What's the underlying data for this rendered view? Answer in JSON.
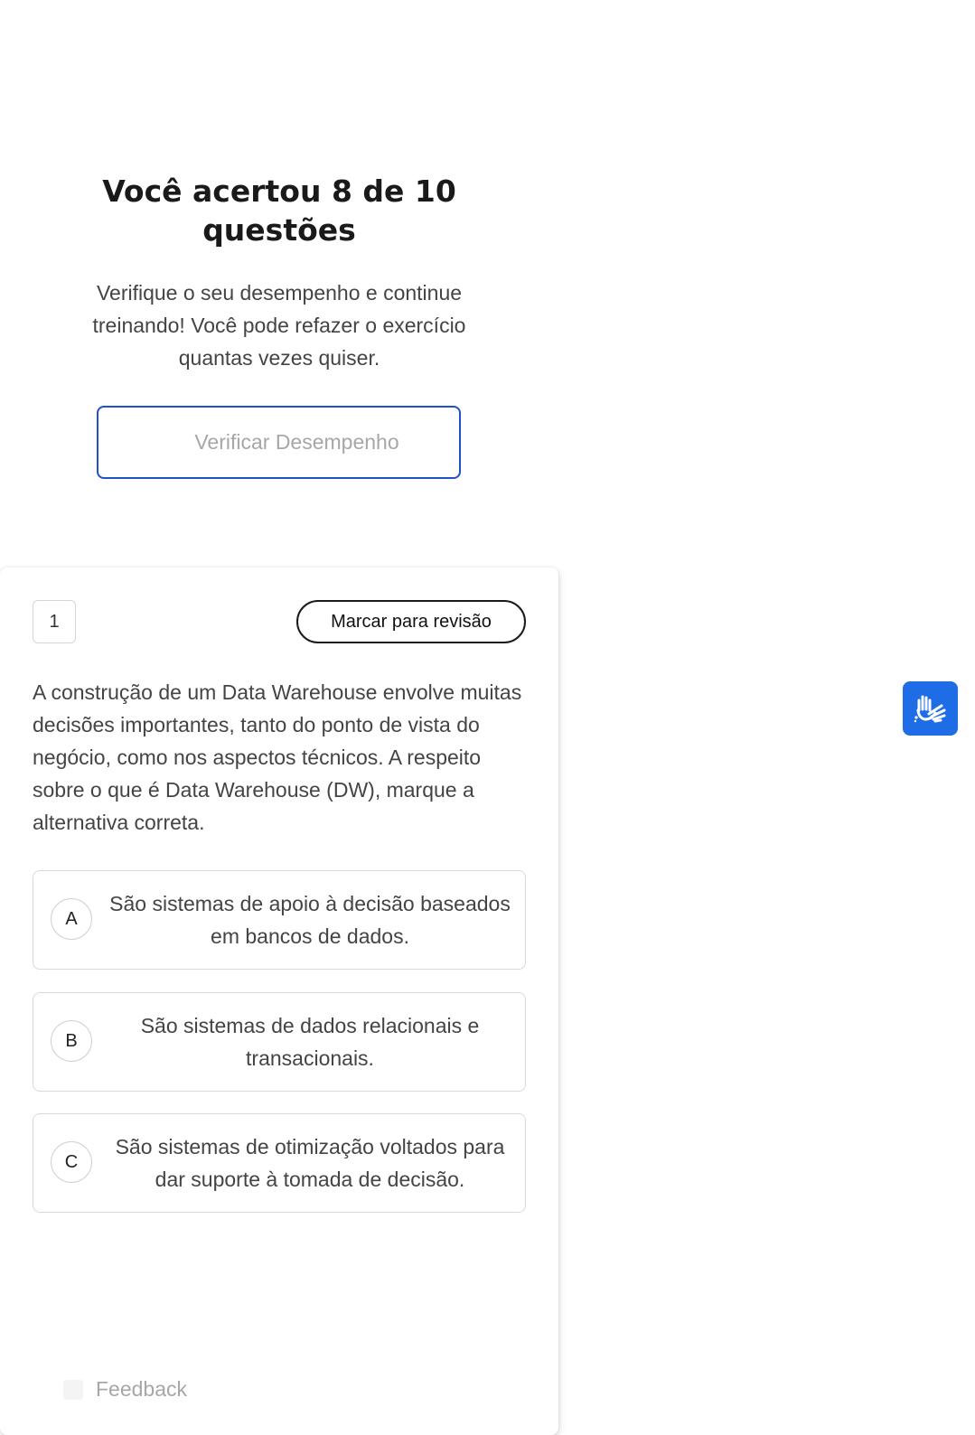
{
  "results": {
    "title": "Você acertou 8 de 10 questões",
    "subtitle": "Verifique o seu desempenho e continue treinando! Você pode refazer o exercício quantas vezes quiser.",
    "verify_button_label": "Verificar Desempenho"
  },
  "question": {
    "number": "1",
    "review_button_label": "Marcar para revisão",
    "text": "A construção de um Data Warehouse envolve muitas decisões importantes, tanto do ponto de vista do negócio, como nos aspectos técnicos. A respeito sobre o que é Data Warehouse (DW), marque a alternativa correta.",
    "options": [
      {
        "letter": "A",
        "text": "São sistemas de apoio à decisão baseados em bancos de dados."
      },
      {
        "letter": "B",
        "text": "São sistemas de dados relacionais e transacionais."
      },
      {
        "letter": "C",
        "text": "São sistemas de otimização voltados para dar suporte à tomada de decisão."
      }
    ]
  },
  "feedback": {
    "label": "Feedback",
    "icon": "feedback-icon"
  },
  "accessibility": {
    "icon": "sign-language-icon"
  },
  "colors": {
    "primary_blue": "#2150c8",
    "accessibility_blue": "#1e6de6",
    "muted_text": "#a7a7a7"
  }
}
